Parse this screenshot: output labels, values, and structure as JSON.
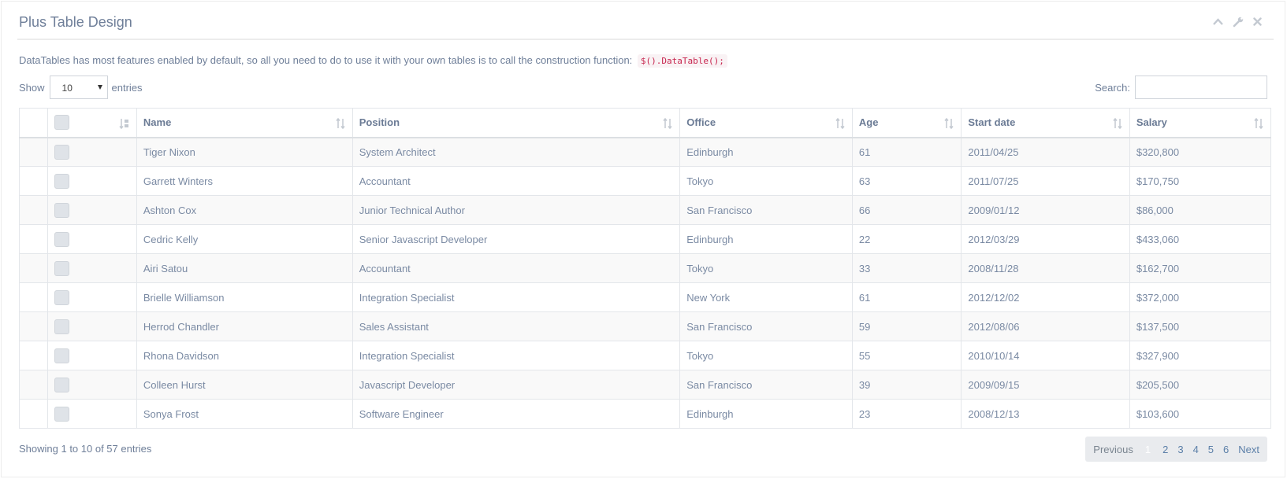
{
  "panel": {
    "title": "Plus Table Design",
    "tools": [
      "chevron-up-icon",
      "wrench-icon",
      "close-icon"
    ]
  },
  "intro": {
    "text": "DataTables has most features enabled by default, so all you need to do to use it with your own tables is to call the construction function:",
    "code": "$().DataTable();"
  },
  "length": {
    "prefix": "Show",
    "value": "10",
    "suffix": "entries"
  },
  "search": {
    "label": "Search:",
    "value": ""
  },
  "table": {
    "headers": [
      "Name",
      "Position",
      "Office",
      "Age",
      "Start date",
      "Salary"
    ],
    "rows": [
      {
        "name": "Tiger Nixon",
        "position": "System Architect",
        "office": "Edinburgh",
        "age": "61",
        "start": "2011/04/25",
        "salary": "$320,800"
      },
      {
        "name": "Garrett Winters",
        "position": "Accountant",
        "office": "Tokyo",
        "age": "63",
        "start": "2011/07/25",
        "salary": "$170,750"
      },
      {
        "name": "Ashton Cox",
        "position": "Junior Technical Author",
        "office": "San Francisco",
        "age": "66",
        "start": "2009/01/12",
        "salary": "$86,000"
      },
      {
        "name": "Cedric Kelly",
        "position": "Senior Javascript Developer",
        "office": "Edinburgh",
        "age": "22",
        "start": "2012/03/29",
        "salary": "$433,060"
      },
      {
        "name": "Airi Satou",
        "position": "Accountant",
        "office": "Tokyo",
        "age": "33",
        "start": "2008/11/28",
        "salary": "$162,700"
      },
      {
        "name": "Brielle Williamson",
        "position": "Integration Specialist",
        "office": "New York",
        "age": "61",
        "start": "2012/12/02",
        "salary": "$372,000"
      },
      {
        "name": "Herrod Chandler",
        "position": "Sales Assistant",
        "office": "San Francisco",
        "age": "59",
        "start": "2012/08/06",
        "salary": "$137,500"
      },
      {
        "name": "Rhona Davidson",
        "position": "Integration Specialist",
        "office": "Tokyo",
        "age": "55",
        "start": "2010/10/14",
        "salary": "$327,900"
      },
      {
        "name": "Colleen Hurst",
        "position": "Javascript Developer",
        "office": "San Francisco",
        "age": "39",
        "start": "2009/09/15",
        "salary": "$205,500"
      },
      {
        "name": "Sonya Frost",
        "position": "Software Engineer",
        "office": "Edinburgh",
        "age": "23",
        "start": "2008/12/13",
        "salary": "$103,600"
      }
    ]
  },
  "footer": {
    "info": "Showing 1 to 10 of 57 entries",
    "previous": "Previous",
    "pages": [
      "1",
      "2",
      "3",
      "4",
      "5",
      "6"
    ],
    "current_page": "1",
    "next": "Next"
  },
  "colors": {
    "accent_link": "#5b7fa8",
    "code_text": "#c7254e",
    "pager_bg": "#e9ebee"
  }
}
